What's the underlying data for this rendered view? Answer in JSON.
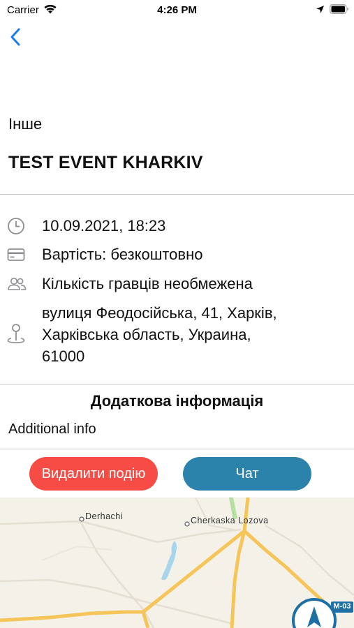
{
  "status_bar": {
    "carrier": "Carrier",
    "time": "4:26 PM"
  },
  "navigation": {
    "back_icon": "chevron-left-icon",
    "accent_color": "#1a7cf5"
  },
  "event": {
    "category": "Інше",
    "title": "TEST EVENT KHARKIV"
  },
  "details": {
    "datetime": "10.09.2021, 18:23",
    "price": "Вартість: безкоштовно",
    "players": "Кількість гравців необмежена",
    "address_line_1": "вулиця Феодосійська, 41, Харків,",
    "address_line_2": "Харківська область, Украина,",
    "address_line_3": "61000"
  },
  "additional": {
    "section_title": "Додаткова інформація",
    "text": "Additional info"
  },
  "actions": {
    "delete_label": "Видалити подію",
    "delete_color": "#f74b45",
    "chat_label": "Чат",
    "chat_color": "#2b82ab"
  },
  "map": {
    "place_1": "Derhachi",
    "place_2": "Cherkaska Lozova",
    "road_badge": "M-03"
  }
}
